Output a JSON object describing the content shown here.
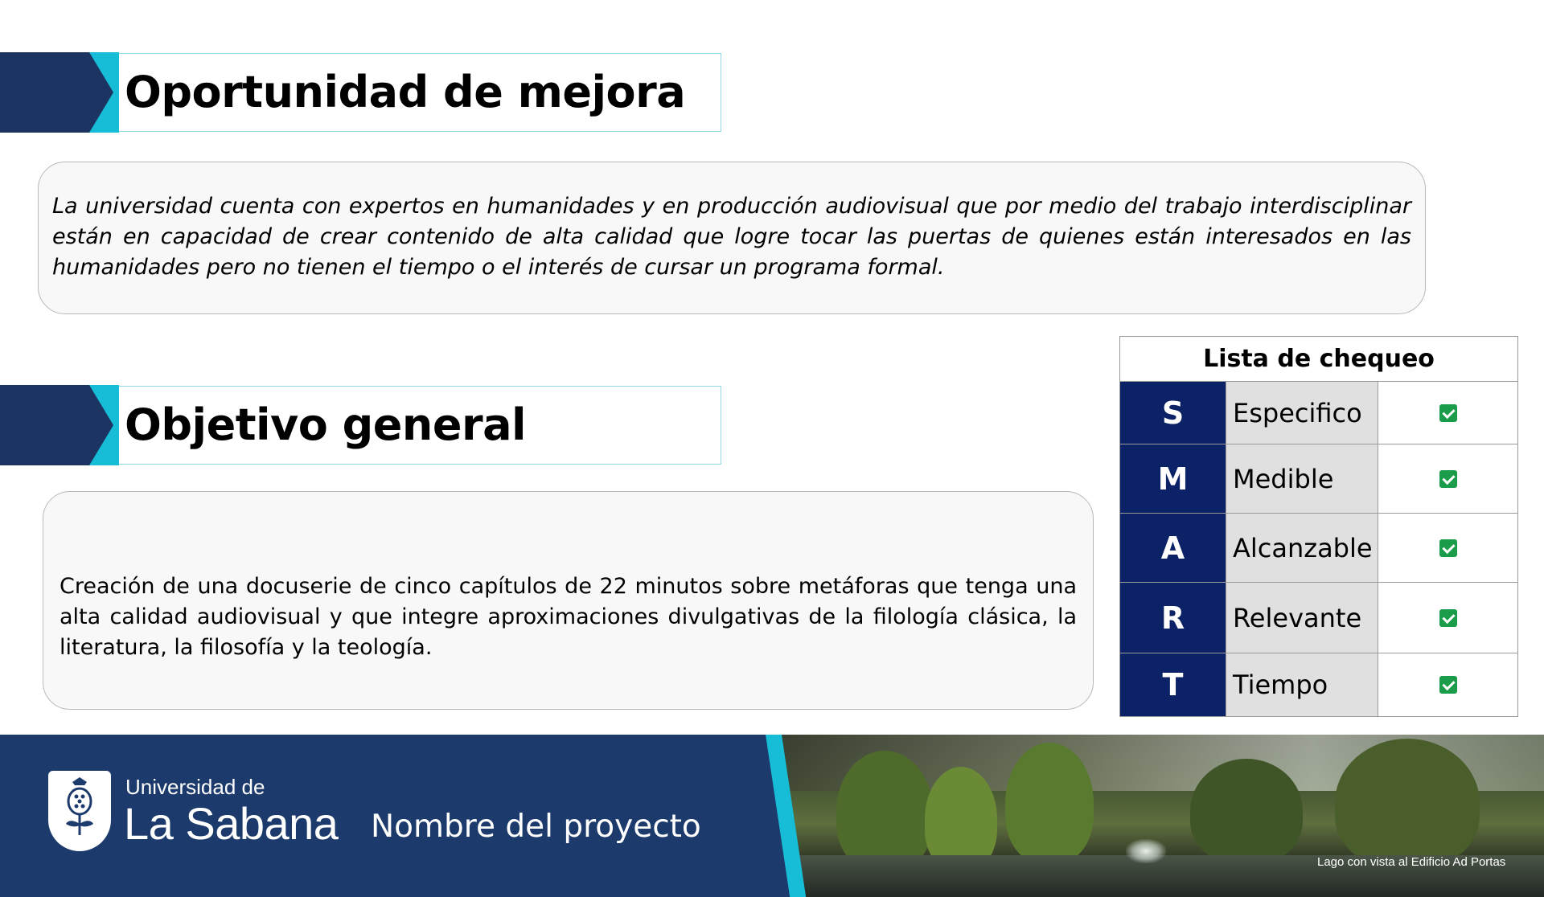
{
  "oportunidad": {
    "title": "Oportunidad de mejora",
    "text": "La universidad cuenta con expertos en humanidades y en producción audiovisual que por medio del trabajo interdisciplinar están en capacidad de crear contenido de alta calidad que logre tocar las puertas de quienes están interesados en las humanidades pero no tienen el tiempo o el interés de cursar un programa formal."
  },
  "objetivo": {
    "title": "Objetivo general",
    "text": "Creación de una docuserie de cinco capítulos de 22 minutos sobre metáforas que tenga una alta calidad audiovisual y que integre aproximaciones divulgativas de la filología clásica, la literatura, la filosofía y la teología."
  },
  "checklist": {
    "title": "Lista de chequeo",
    "rows": [
      {
        "letter": "S",
        "label": "Especifico",
        "checked": true
      },
      {
        "letter": "M",
        "label": "Medible",
        "checked": true
      },
      {
        "letter": "A",
        "label": "Alcanzable",
        "checked": true
      },
      {
        "letter": "R",
        "label": "Relevante",
        "checked": true
      },
      {
        "letter": "T",
        "label": "Tiempo",
        "checked": true
      }
    ]
  },
  "footer": {
    "logo_line1": "Universidad de",
    "logo_line2": "La Sabana",
    "project_name": "Nombre del proyecto",
    "photo_caption": "Lago con vista al Edificio Ad Portas"
  },
  "colors": {
    "navy": "#1b3461",
    "cyan": "#17bcd6",
    "table_navy": "#0b2266",
    "check_green": "#1b9c4a"
  }
}
